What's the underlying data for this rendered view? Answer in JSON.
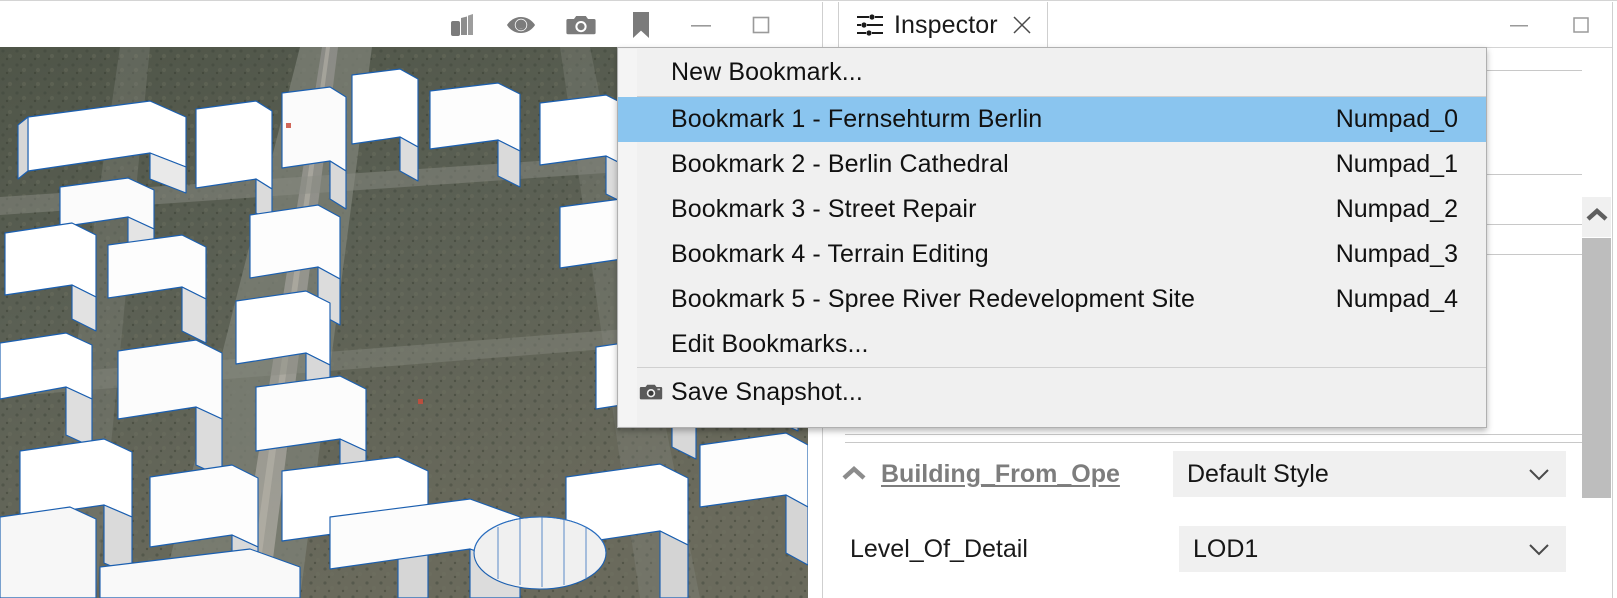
{
  "toolbar": {
    "buttons": [
      {
        "name": "layers-icon",
        "label": "Layers"
      },
      {
        "name": "eye-icon",
        "label": "Visibility"
      },
      {
        "name": "camera-icon",
        "label": "Camera"
      },
      {
        "name": "bookmark-icon",
        "label": "Bookmarks"
      },
      {
        "name": "minimize-icon",
        "label": "Minimize"
      },
      {
        "name": "maximize-icon",
        "label": "Maximize"
      }
    ]
  },
  "bookmark_menu": {
    "new_bookmark": "New Bookmark...",
    "bookmarks": [
      {
        "label": "Bookmark 1 - Fernsehturm Berlin",
        "shortcut": "Numpad_0",
        "selected": true
      },
      {
        "label": "Bookmark 2 - Berlin Cathedral",
        "shortcut": "Numpad_1",
        "selected": false
      },
      {
        "label": "Bookmark 3 - Street Repair",
        "shortcut": "Numpad_2",
        "selected": false
      },
      {
        "label": "Bookmark 4 - Terrain Editing",
        "shortcut": "Numpad_3",
        "selected": false
      },
      {
        "label": "Bookmark 5 - Spree River Redevelopment Site",
        "shortcut": "Numpad_4",
        "selected": false
      }
    ],
    "edit_bookmarks": "Edit Bookmarks...",
    "save_snapshot": "Save Snapshot...",
    "highlight_color": "#8ac5ef"
  },
  "inspector": {
    "tab_title": "Inspector",
    "tab_icon": "sliders-icon",
    "close_icon": "close-icon",
    "window_controls": [
      {
        "name": "minimize-icon",
        "label": "Minimize"
      },
      {
        "name": "maximize-icon",
        "label": "Maximize"
      }
    ],
    "properties": [
      {
        "name": "Building_From_Ope",
        "is_link": true,
        "value": "Default Style"
      },
      {
        "name": "Level_Of_Detail",
        "is_link": false,
        "value": "LOD1"
      }
    ],
    "scrollbar": {
      "up_arrow": "chevron-up-icon"
    }
  },
  "viewport": {
    "name": "3d-city-viewport",
    "description": "3D city model of Berlin with white extruded buildings over aerial imagery"
  }
}
